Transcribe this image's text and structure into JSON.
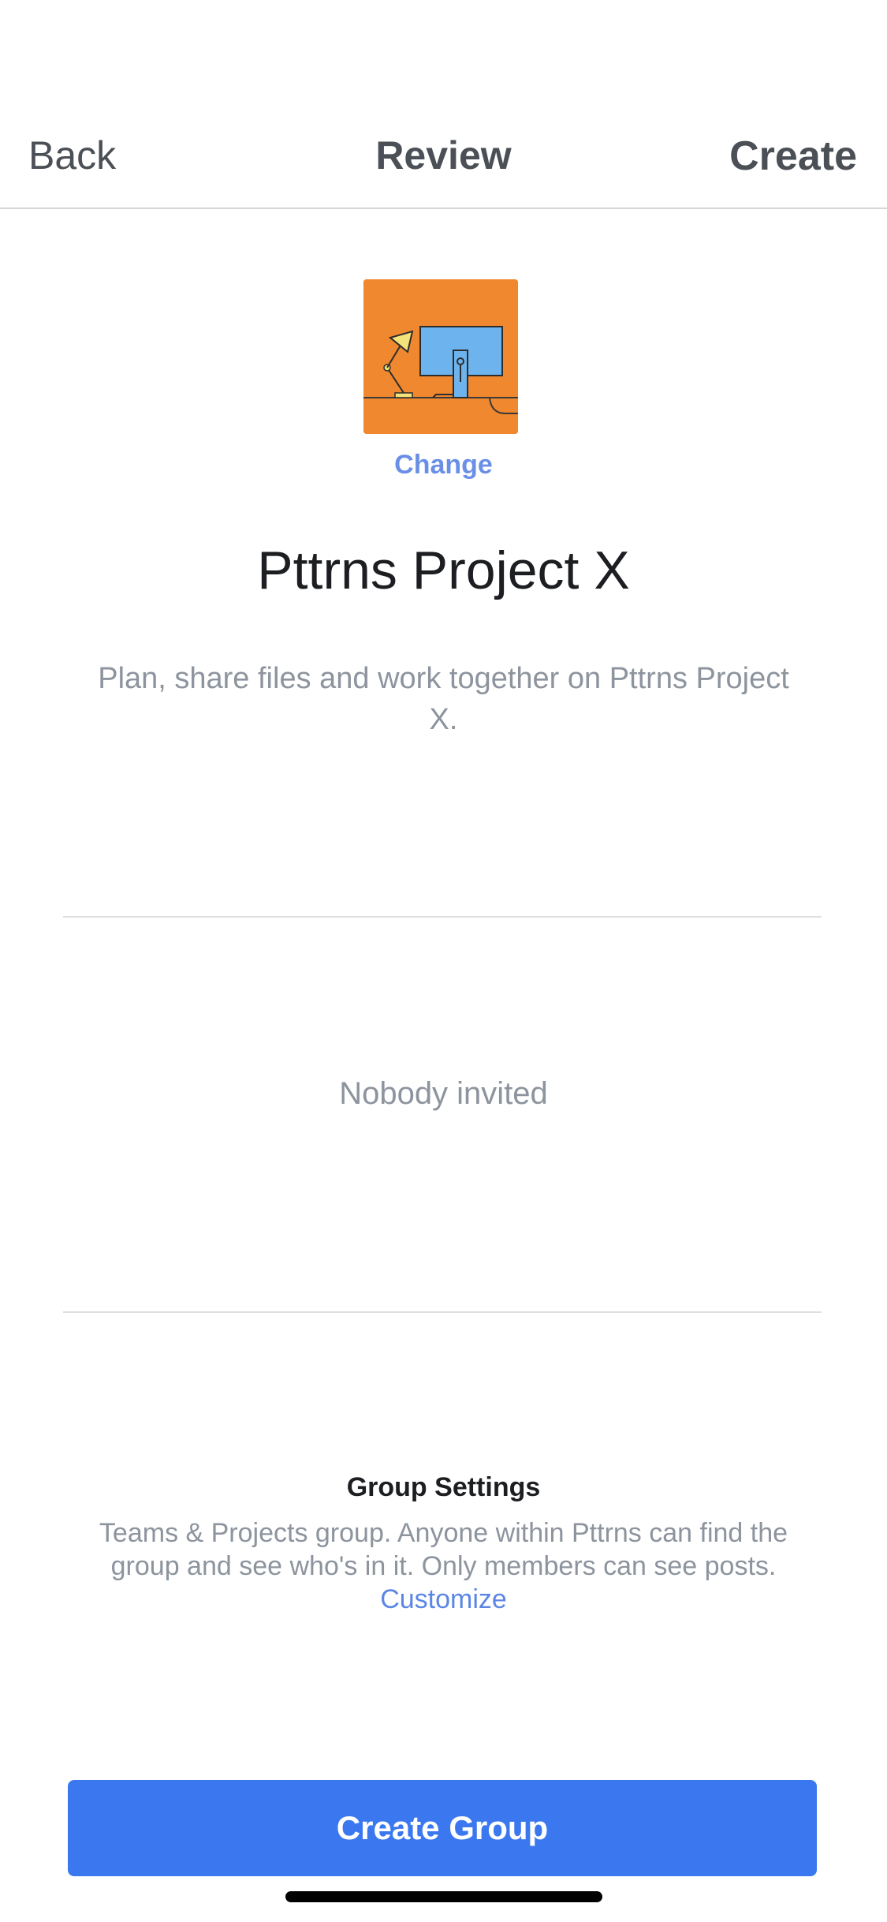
{
  "nav": {
    "back_label": "Back",
    "title": "Review",
    "create_label": "Create"
  },
  "cover": {
    "icon": "desk-monitor-lamp-illustration",
    "change_label": "Change",
    "background_color": "#f0882f"
  },
  "group": {
    "name": "Pttrns Project X",
    "description": "Plan, share files and work together on Pttrns Project X."
  },
  "invited": {
    "empty_text": "Nobody invited"
  },
  "settings": {
    "title": "Group Settings",
    "text": "Teams & Projects group. Anyone within Pttrns can find the group and see who's in it. Only members can see posts.",
    "customize_label": "Customize"
  },
  "primary_button": {
    "label": "Create Group",
    "color": "#3b78f0"
  }
}
